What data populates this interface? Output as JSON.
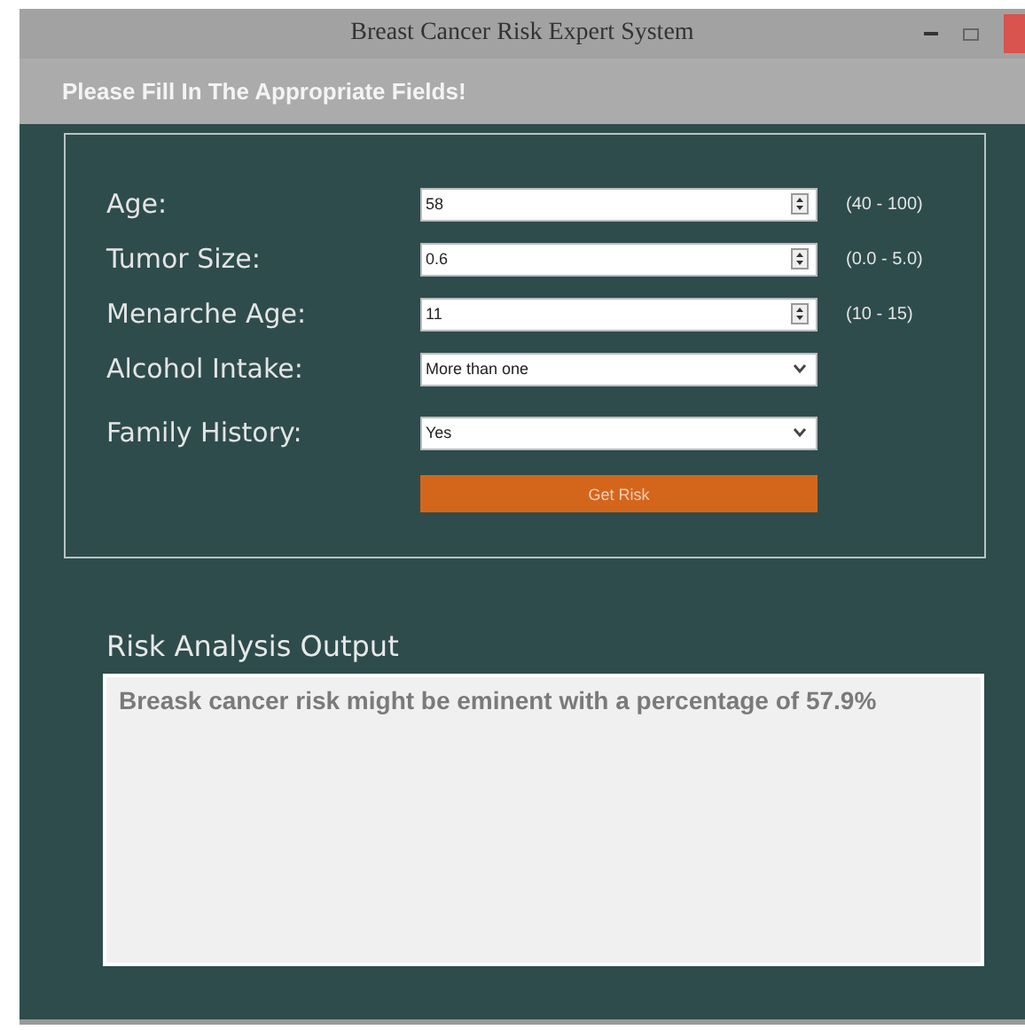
{
  "window": {
    "title": "Breast Cancer Risk Expert System"
  },
  "instruction": "Please Fill In The Appropriate Fields!",
  "fields": [
    {
      "kind": "spin",
      "label": "Age:",
      "value": "58",
      "range": "(40 - 100)"
    },
    {
      "kind": "spin",
      "label": "Tumor Size:",
      "value": "0.6",
      "range": "(0.0 - 5.0)"
    },
    {
      "kind": "spin",
      "label": "Menarche Age:",
      "value": "11",
      "range": "(10 - 15)"
    },
    {
      "kind": "select",
      "label": "Alcohol Intake:",
      "value": "More than one"
    },
    {
      "kind": "select",
      "label": "Family History:",
      "value": "Yes"
    }
  ],
  "button": "Get Risk",
  "output": {
    "title": "Risk Analysis Output",
    "text": "Breask cancer risk might be eminent with a percentage of 57.9%"
  }
}
